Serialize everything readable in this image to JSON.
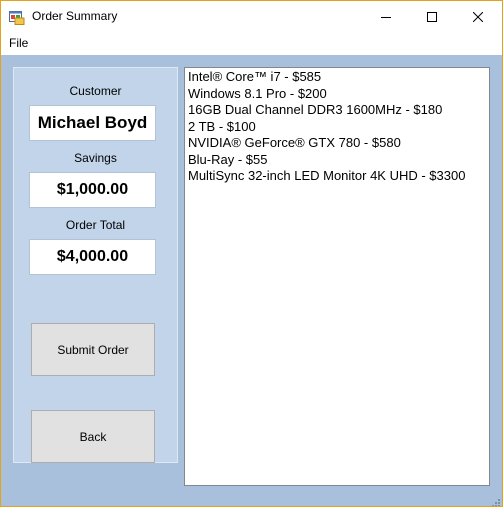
{
  "window": {
    "title": "Order Summary",
    "icon": "windows-form-icon"
  },
  "menu": {
    "file_label": "File"
  },
  "customer": {
    "label": "Customer",
    "value": "Michael Boyd"
  },
  "savings": {
    "label": "Savings",
    "value": "$1,000.00"
  },
  "order_total": {
    "label": "Order Total",
    "value": "$4,000.00"
  },
  "buttons": {
    "submit_label": "Submit Order",
    "back_label": "Back"
  },
  "order_items": [
    "Intel® Core™ i7 - $585",
    "Windows 8.1 Pro - $200",
    "16GB Dual Channel DDR3 1600MHz - $180",
    "2 TB - $100",
    "NVIDIA® GeForce® GTX 780 - $580",
    "Blu-Ray - $55",
    "MultiSync 32-inch LED Monitor 4K UHD - $3300"
  ],
  "colors": {
    "window_border": "#e3a21a",
    "client_background": "#a9c0dc",
    "panel_background": "#c1d4ea",
    "button_background": "#e1e1e1"
  }
}
